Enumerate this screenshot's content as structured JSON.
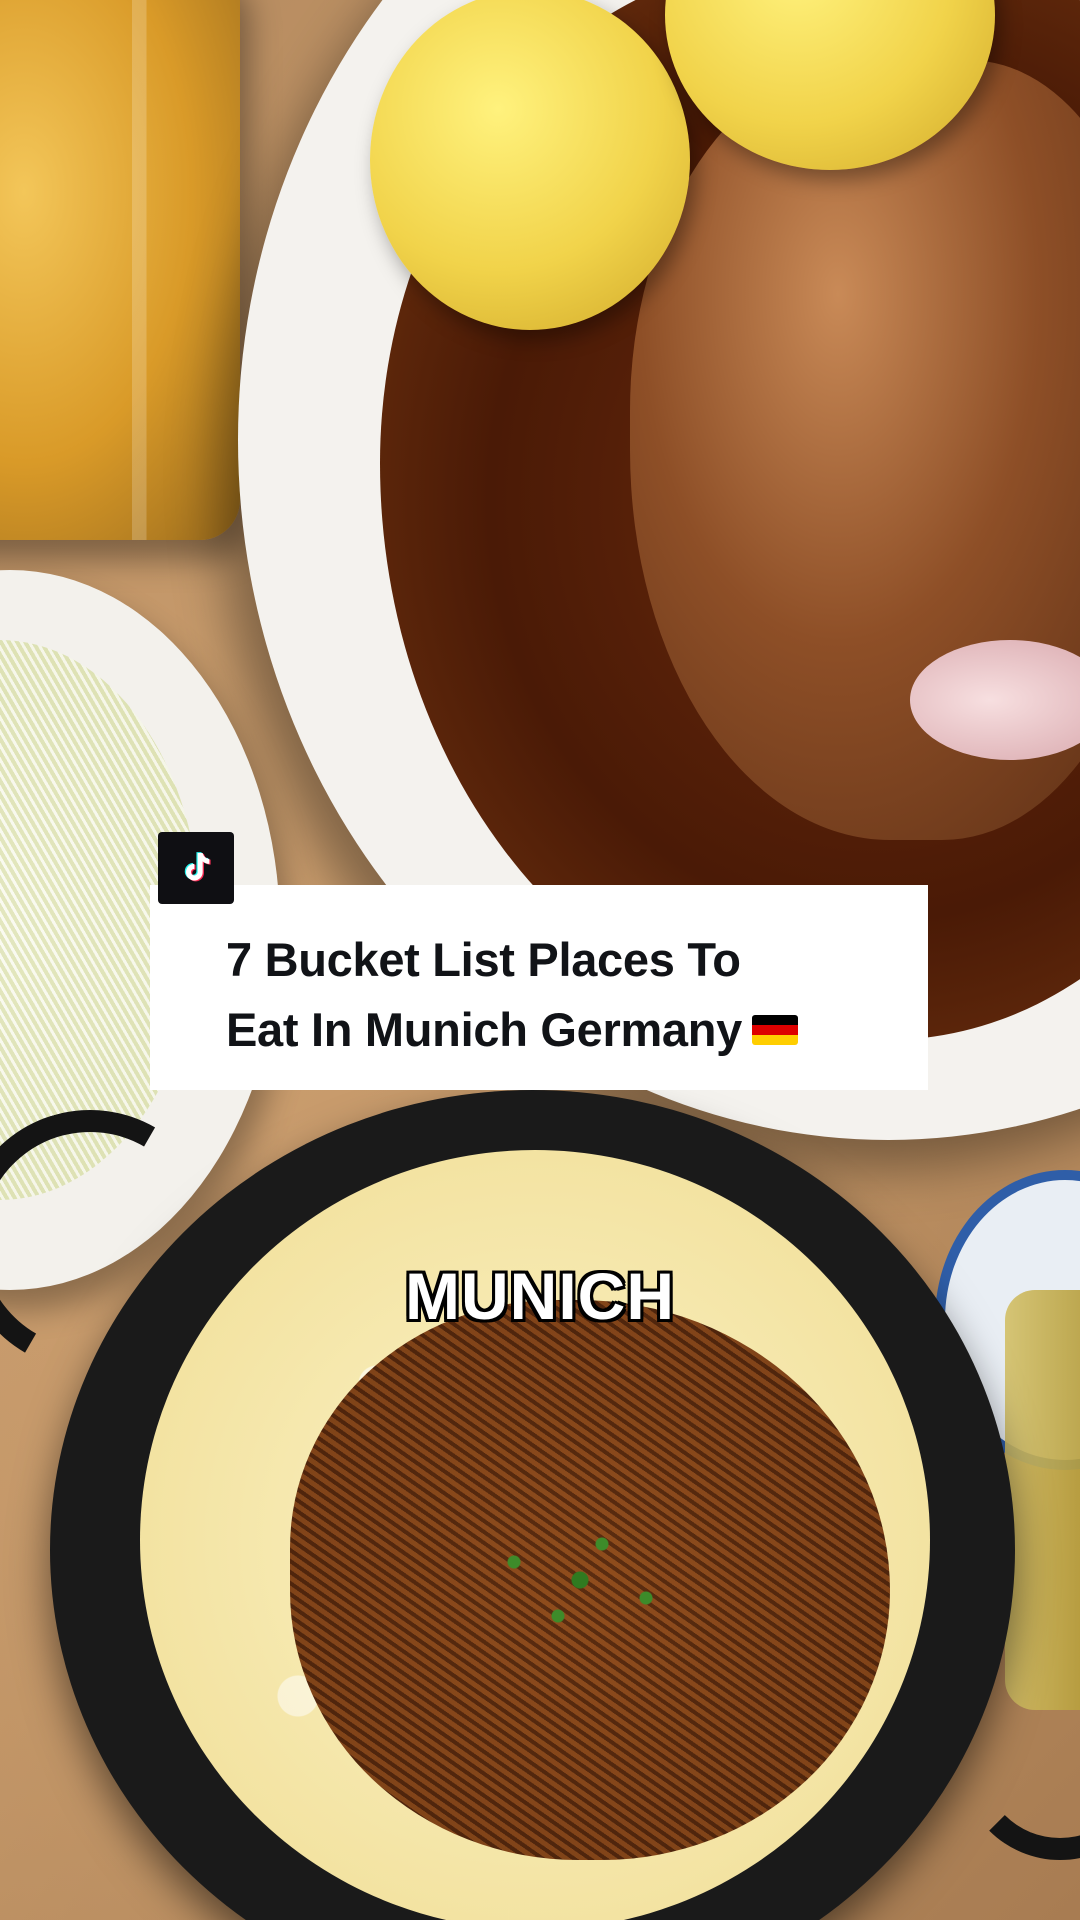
{
  "video": {
    "title_card": {
      "line1": "7 Bucket List Places To",
      "line2": "Eat In Munich Germany",
      "flag_icon": "germany-flag-icon",
      "flag_colors": [
        "#000000",
        "#dd0000",
        "#ffce00"
      ]
    },
    "badge": {
      "icon": "tiktok-logo-icon",
      "background": "#0f0f13"
    },
    "caption": "MUNICH"
  }
}
